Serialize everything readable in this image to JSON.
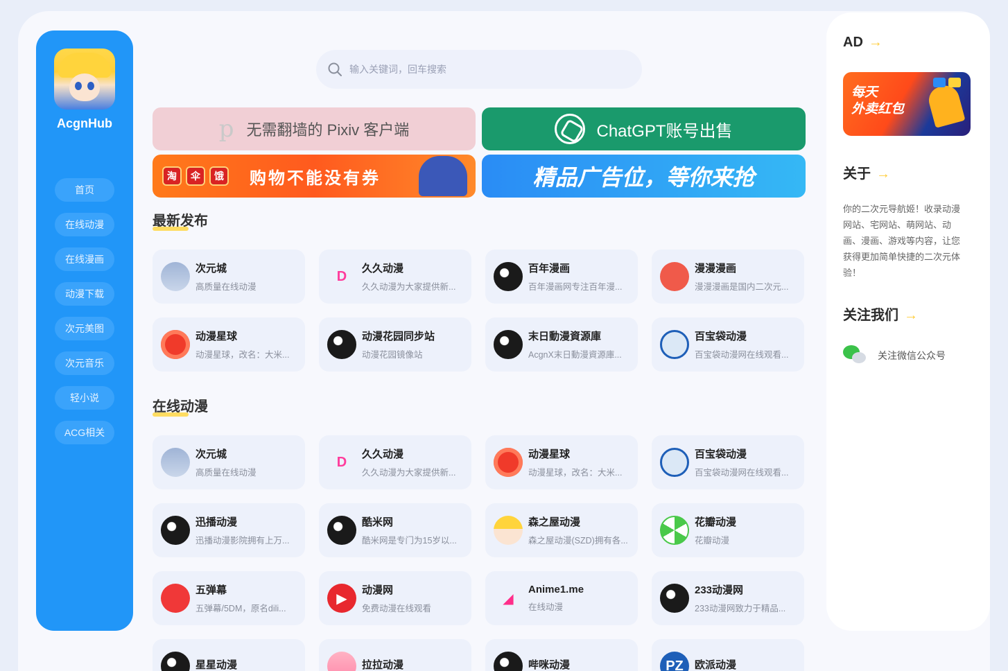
{
  "brand": {
    "name": "AcgnHub"
  },
  "nav": [
    "首页",
    "在线动漫",
    "在线漫画",
    "动漫下载",
    "次元美图",
    "次元音乐",
    "轻小说",
    "ACG相关"
  ],
  "search": {
    "placeholder": "输入关键词，回车搜索",
    "icon": "search-icon"
  },
  "banners": {
    "pixiv": "无需翻墙的 Pixiv 客户端",
    "chatgpt": "ChatGPT账号出售",
    "shopping": "购物不能没有券",
    "shopping_chips": [
      "淘",
      "伞",
      "饿"
    ],
    "ad_slot": "精品广告位，等你来抢"
  },
  "sections": [
    {
      "title": "最新发布",
      "items": [
        {
          "name": "次元城",
          "desc": "高质量在线动漫",
          "icon": "anime"
        },
        {
          "name": "久久动漫",
          "desc": "久久动漫为大家提供新...",
          "icon": "d",
          "glyph": "D"
        },
        {
          "name": "百年漫画",
          "desc": "百年漫画网专注百年漫...",
          "icon": "globe"
        },
        {
          "name": "漫漫漫画",
          "desc": "漫漫漫画是国内二次元...",
          "icon": "gift"
        },
        {
          "name": "动漫星球",
          "desc": "动漫星球，改名：大米...",
          "icon": "planet"
        },
        {
          "name": "动漫花园同步站",
          "desc": "动漫花园镜像站",
          "icon": "globe"
        },
        {
          "name": "末日動漫資源庫",
          "desc": "AcgnX末日動漫資源庫...",
          "icon": "globe"
        },
        {
          "name": "百宝袋动漫",
          "desc": "百宝袋动漫网在线观看...",
          "icon": "robot"
        }
      ]
    },
    {
      "title": "在线动漫",
      "items": [
        {
          "name": "次元城",
          "desc": "高质量在线动漫",
          "icon": "anime"
        },
        {
          "name": "久久动漫",
          "desc": "久久动漫为大家提供新...",
          "icon": "d",
          "glyph": "D"
        },
        {
          "name": "动漫星球",
          "desc": "动漫星球，改名：大米...",
          "icon": "planet"
        },
        {
          "name": "百宝袋动漫",
          "desc": "百宝袋动漫网在线观看...",
          "icon": "robot"
        },
        {
          "name": "迅播动漫",
          "desc": "迅播动漫影院拥有上万...",
          "icon": "globe"
        },
        {
          "name": "酷米网",
          "desc": "酷米网是专门为15岁以...",
          "icon": "globe"
        },
        {
          "name": "森之屋动漫",
          "desc": "森之屋动漫(SZD)拥有各...",
          "icon": "girl"
        },
        {
          "name": "花瓣动漫",
          "desc": "花瓣动漫",
          "icon": "green"
        },
        {
          "name": "五弹幕",
          "desc": "五弹幕/5DM，原名dili...",
          "icon": "rainbow"
        },
        {
          "name": "动漫网",
          "desc": "免费动漫在线观看",
          "icon": "play",
          "glyph": "▶"
        },
        {
          "name": "Anime1.me",
          "desc": "在线动漫",
          "icon": "pinkA",
          "glyph": "◢"
        },
        {
          "name": "233动漫网",
          "desc": "233动漫网致力于精品...",
          "icon": "globe"
        },
        {
          "name": "星星动漫",
          "desc": "",
          "icon": "globe"
        },
        {
          "name": "拉拉动漫",
          "desc": "",
          "icon": "pink"
        },
        {
          "name": "哔咪动漫",
          "desc": "",
          "icon": "globe"
        },
        {
          "name": "欧派动漫",
          "desc": "",
          "icon": "blue",
          "glyph": "PZ"
        }
      ]
    }
  ],
  "right_panel": {
    "ad_title": "AD",
    "ad_image_text": [
      "每天",
      "外卖红包"
    ],
    "about_title": "关于",
    "about_text": "你的二次元导航姬！收录动漫网站、宅网站、萌网站、动画、漫画、游戏等内容，让您获得更加简单快捷的二次元体验！",
    "follow_title": "关注我们",
    "follow_item": "关注微信公众号",
    "arrow": "→"
  },
  "colors": {
    "sidebar": "#2196f8",
    "accent_yellow": "#ffd43a",
    "chatgpt_green": "#1a9a6c"
  }
}
